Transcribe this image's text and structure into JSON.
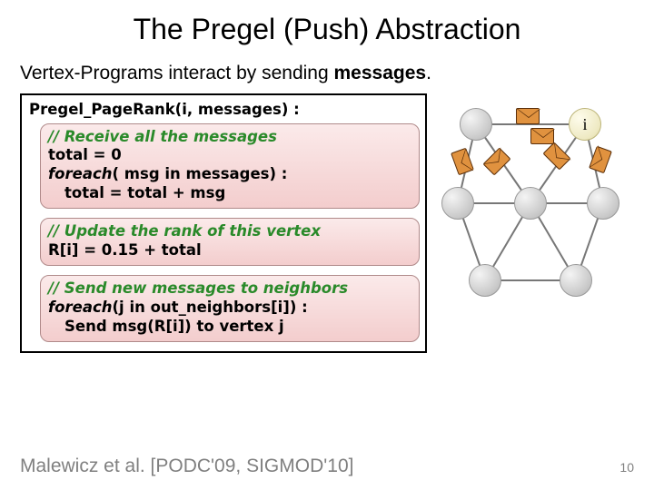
{
  "title": "The Pregel (Push) Abstraction",
  "subtitle_plain": "Vertex-Programs interact by sending ",
  "subtitle_bold": "messages",
  "subtitle_end": ".",
  "code": {
    "header": "Pregel_PageRank(i, messages) :",
    "block1": {
      "l1": "// Receive all the messages",
      "l2": "total = 0",
      "l3a": "foreach",
      "l3b": "( msg in messages) :",
      "l4": "total = total + msg"
    },
    "block2": {
      "l1": "// Update the rank of this vertex",
      "l2": "R[i] = 0.15 + total"
    },
    "block3": {
      "l1": "// Send new messages to neighbors",
      "l2a": "foreach",
      "l2b": "(j in out_neighbors[i]) :",
      "l3": "Send  msg(R[i]) to vertex j"
    }
  },
  "graph": {
    "vertex_label": "i"
  },
  "citation": "Malewicz et al. [PODC'09, SIGMOD'10]",
  "page": "10"
}
